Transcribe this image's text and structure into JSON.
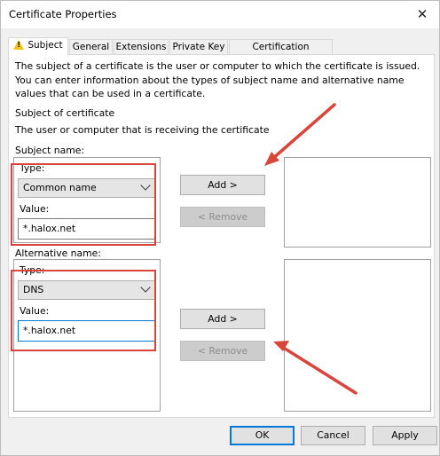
{
  "window": {
    "title": "Certificate Properties",
    "close_glyph": "✕"
  },
  "tabs": [
    {
      "label": "Subject",
      "active": true
    },
    {
      "label": "General"
    },
    {
      "label": "Extensions"
    },
    {
      "label": "Private Key"
    },
    {
      "label": "Certification Authority"
    }
  ],
  "description": "The subject of a certificate is the user or computer to which the certificate is issued. You can enter information about the types of subject name and alternative name values that can be used in a certificate.",
  "subject_of_certificate": {
    "heading": "Subject of certificate",
    "subtext": "The user or computer that is receiving the certificate"
  },
  "subject_name": {
    "label": "Subject name:",
    "type_label": "Type:",
    "type_value": "Common name",
    "value_label": "Value:",
    "value": "*.halox.net",
    "add_label": "Add >",
    "remove_label": "< Remove"
  },
  "alternative_name": {
    "label": "Alternative name:",
    "type_label": "Type:",
    "type_value": "DNS",
    "value_label": "Value:",
    "value": "*.halox.net",
    "add_label": "Add >",
    "remove_label": "< Remove"
  },
  "footer": {
    "ok": "OK",
    "cancel": "Cancel",
    "apply": "Apply"
  },
  "colors": {
    "annotation": "#d9443b",
    "focus": "#0078d7",
    "warning_icon": "#f1c40f"
  }
}
